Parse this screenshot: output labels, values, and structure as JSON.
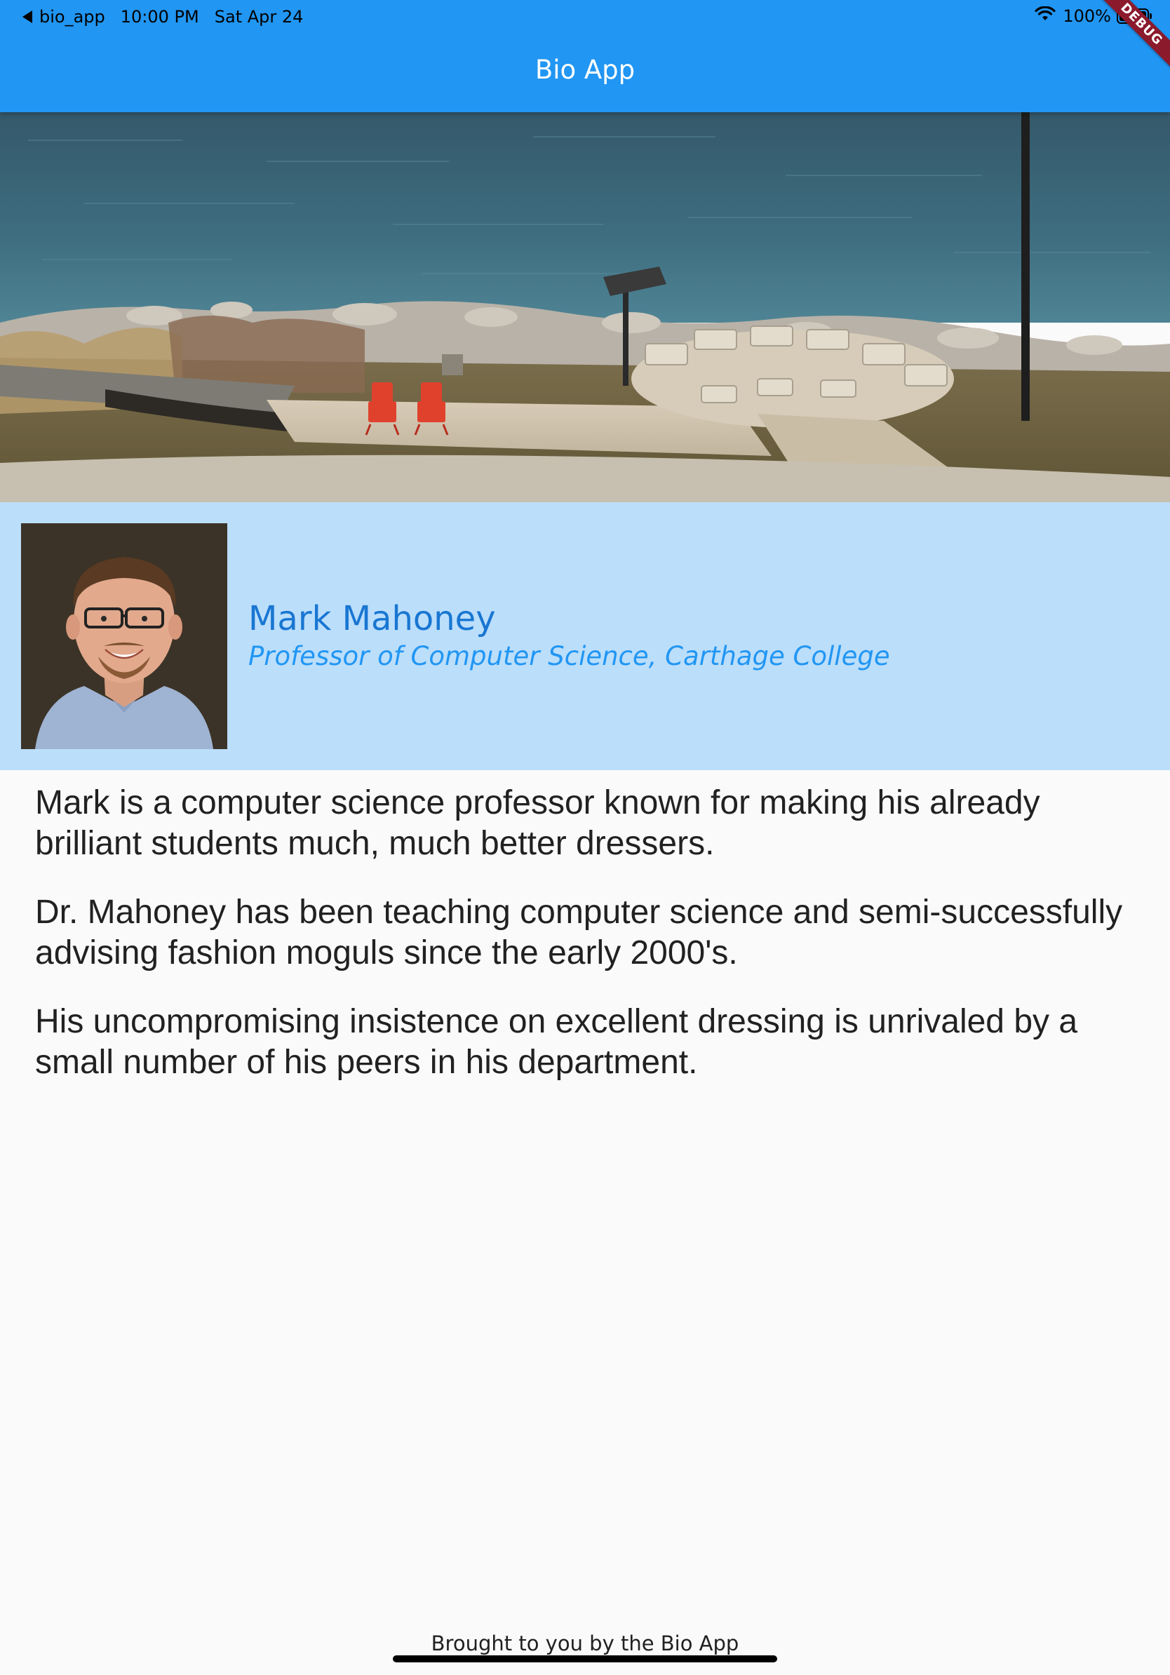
{
  "status_bar": {
    "back_app": "bio_app",
    "time": "10:00 PM",
    "date": "Sat Apr 24",
    "battery": "100%"
  },
  "app_bar": {
    "title": "Bio App"
  },
  "debug_banner": "DEBUG",
  "header_image": {
    "icon": "lakefront-photo",
    "description_name": "lakeshore campus header photo"
  },
  "profile": {
    "avatar_icon": "profile-photo",
    "name": "Mark Mahoney",
    "title": "Professor of Computer Science, Carthage College"
  },
  "bio": {
    "paragraphs": [
      "Mark is a computer science professor known for making his already brilliant students much, much better dressers.",
      "Dr. Mahoney has been teaching computer science and semi-successfully advising fashion moguls since the early 2000's.",
      "His uncompromising insistence on excellent dressing is unrivaled by a small number of his peers in his department."
    ]
  },
  "footer": {
    "text": "Brought to you by the Bio App"
  },
  "colors": {
    "app_bar": "#2196f3",
    "profile_bg": "#bbdefb",
    "name_color": "#1976d2",
    "title_color": "#2196f3",
    "body_text": "#212121",
    "page_bg": "#fafafa"
  }
}
